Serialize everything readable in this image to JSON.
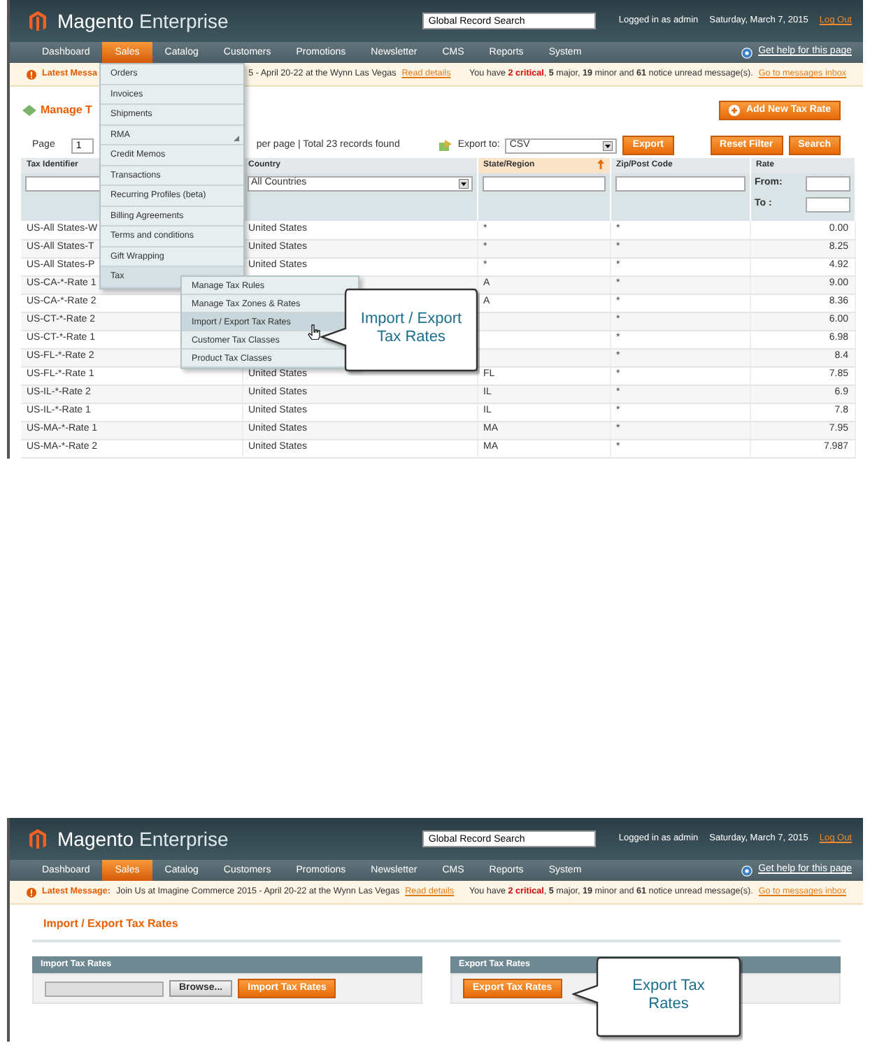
{
  "manage_screen": {
    "header": {
      "logo": "Magento",
      "edition": "Enterprise",
      "search_value": "Global Record Search",
      "user": "Logged in as admin",
      "date": "Saturday, March 7, 2015",
      "logout": "Log Out"
    },
    "nav": [
      {
        "label": "Dashboard",
        "selected": false
      },
      {
        "label": "Sales",
        "selected": true
      },
      {
        "label": "Catalog",
        "selected": false
      },
      {
        "label": "Customers",
        "selected": false
      },
      {
        "label": "Promotions",
        "selected": false
      },
      {
        "label": "Newsletter",
        "selected": false
      },
      {
        "label": "CMS",
        "selected": false
      },
      {
        "label": "Reports",
        "selected": false
      },
      {
        "label": "System",
        "selected": false
      }
    ],
    "help": "Get help for this page",
    "message": {
      "label": "Latest Messa",
      "text": "5 - April 20-22 at the Wynn Las Vegas",
      "link": "Read details",
      "notice": "You have **2 critical**, **5** major, **19** minor and **61** notice unread message(s).",
      "notice_link": "Go to messages inbox"
    },
    "title": "Manage T",
    "add_button": "Add New Tax Rate",
    "pager": {
      "label": "Page",
      "page": "1",
      "info": "per page | Total 23 records found",
      "export_label": "Export to:",
      "export_format": "CSV",
      "export_button": "Export",
      "reset_button": "Reset Filter",
      "search_button": "Search"
    },
    "columns": [
      {
        "label": "Tax Identifier",
        "sorted": false
      },
      {
        "label": "Country",
        "sorted": false
      },
      {
        "label": "State/Region",
        "sorted": true
      },
      {
        "label": "Zip/Post Code",
        "sorted": false
      },
      {
        "label": "Rate",
        "sorted": false
      }
    ],
    "filters": {
      "country": "All Countries",
      "from": "From:",
      "to": "To :"
    },
    "rows": [
      {
        "id": "US-All States-W",
        "country": "United States",
        "state": "*",
        "zip": "*",
        "rate": "0.00"
      },
      {
        "id": "US-All States-T",
        "country": "United States",
        "state": "*",
        "zip": "*",
        "rate": "8.25"
      },
      {
        "id": "US-All States-P",
        "country": "United States",
        "state": "*",
        "zip": "*",
        "rate": "4.92"
      },
      {
        "id": "US-CA-*-Rate 1",
        "state": "A",
        "zip": "*",
        "rate": "9.00"
      },
      {
        "id": "US-CA-*-Rate 2",
        "state": "A",
        "zip": "*",
        "rate": "8.36"
      },
      {
        "id": "US-CT-*-Rate 2",
        "zip": "*",
        "rate": "6.00"
      },
      {
        "id": "US-CT-*-Rate 1",
        "zip": "*",
        "rate": "6.98"
      },
      {
        "id": "US-FL-*-Rate 2",
        "zip": "*",
        "rate": "8.4"
      },
      {
        "id": "US-FL-*-Rate 1",
        "country": "United States",
        "state": "FL",
        "zip": "*",
        "rate": "7.85"
      },
      {
        "id": "US-IL-*-Rate 2",
        "country": "United States",
        "state": "IL",
        "zip": "*",
        "rate": "6.9"
      },
      {
        "id": "US-IL-*-Rate 1",
        "country": "United States",
        "state": "IL",
        "zip": "*",
        "rate": "7.8"
      },
      {
        "id": "US-MA-*-Rate 1",
        "country": "United States",
        "state": "MA",
        "zip": "*",
        "rate": "7.95"
      },
      {
        "id": "US-MA-*-Rate 2",
        "country": "United States",
        "state": "MA",
        "zip": "*",
        "rate": "7.987"
      }
    ],
    "sales_menu": [
      {
        "label": "Orders",
        "expanded": false,
        "arrow": false
      },
      {
        "label": "Invoices",
        "expanded": false,
        "arrow": false
      },
      {
        "label": "Shipments",
        "expanded": false,
        "arrow": false
      },
      {
        "label": "RMA",
        "expanded": false,
        "arrow": true
      },
      {
        "label": "Credit Memos",
        "expanded": false,
        "arrow": false
      },
      {
        "label": "Transactions",
        "expanded": false,
        "arrow": false
      },
      {
        "label": "Recurring Profiles (beta)",
        "expanded": false,
        "arrow": false
      },
      {
        "label": "Billing Agreements",
        "expanded": false,
        "arrow": false
      },
      {
        "label": "Terms and conditions",
        "expanded": false,
        "arrow": false
      },
      {
        "label": "Gift Wrapping",
        "expanded": false,
        "arrow": false
      },
      {
        "label": "Tax",
        "expanded": true,
        "arrow": false
      }
    ],
    "tax_menu": [
      {
        "label": "Manage Tax Rules",
        "selected": false
      },
      {
        "label": "Manage Tax Zones & Rates",
        "selected": false
      },
      {
        "label": "Import / Export Tax Rates",
        "selected": true
      },
      {
        "label": "Customer Tax Classes",
        "selected": false
      },
      {
        "label": "Product Tax Classes",
        "selected": false
      }
    ],
    "callout": "Import / Export Tax Rates"
  },
  "import_screen": {
    "header": {
      "logo": "Magento",
      "edition": "Enterprise",
      "search_value": "Global Record Search",
      "user": "Logged in as admin",
      "date": "Saturday, March 7, 2015",
      "logout": "Log Out"
    },
    "nav": [
      {
        "label": "Dashboard",
        "selected": false
      },
      {
        "label": "Sales",
        "selected": true
      },
      {
        "label": "Catalog",
        "selected": false
      },
      {
        "label": "Customers",
        "selected": false
      },
      {
        "label": "Promotions",
        "selected": false
      },
      {
        "label": "Newsletter",
        "selected": false
      },
      {
        "label": "CMS",
        "selected": false
      },
      {
        "label": "Reports",
        "selected": false
      },
      {
        "label": "System",
        "selected": false
      }
    ],
    "help": "Get help for this page",
    "message": {
      "label": "Latest Message:",
      "text": "Join Us at Imagine Commerce 2015 - April 20-22 at the Wynn Las Vegas",
      "link": "Read details",
      "notice": "You have **2 critical**, **5** major, **19** minor and **61** notice unread message(s).",
      "notice_link": "Go to messages inbox"
    },
    "title": "Import / Export Tax Rates",
    "import_section": {
      "title": "Import Tax Rates",
      "browse_button": "Browse...",
      "import_button": "Import Tax Rates"
    },
    "export_section": {
      "title": "Export Tax Rates",
      "export_button": "Export Tax Rates"
    },
    "callout": "Export Tax Rates"
  }
}
